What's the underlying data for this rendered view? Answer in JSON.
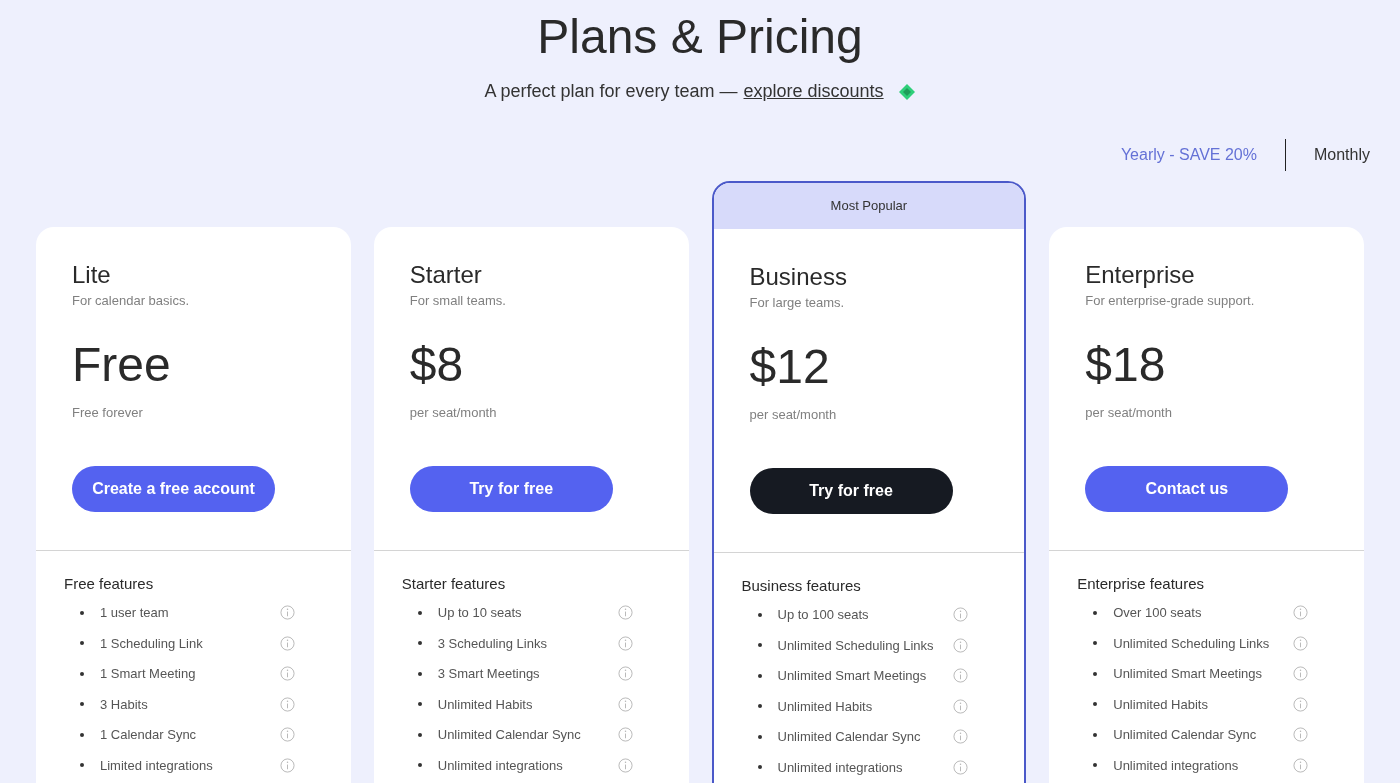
{
  "header": {
    "title": "Plans & Pricing",
    "subtitle": "A perfect plan for every team —",
    "link": "explore discounts"
  },
  "billing": [
    {
      "label": "Yearly - SAVE 20%",
      "selected": true
    },
    {
      "label": "Monthly",
      "selected": false
    }
  ],
  "plans": [
    {
      "name": "Lite",
      "tagline": "For calendar basics.",
      "price": "Free",
      "price_note": "Free forever",
      "button": "Create a free account",
      "featured": false,
      "features_title": "Free features",
      "features": [
        "1 user team",
        "1 Scheduling Link",
        "1 Smart Meeting",
        "3 Habits",
        "1 Calendar Sync",
        "Limited integrations"
      ]
    },
    {
      "name": "Starter",
      "tagline": "For small teams.",
      "price": "$8",
      "price_note": "per seat/month",
      "button": "Try for free",
      "featured": false,
      "features_title": "Starter features",
      "features": [
        "Up to 10 seats",
        "3 Scheduling Links",
        "3 Smart Meetings",
        "Unlimited Habits",
        "Unlimited Calendar Sync",
        "Unlimited integrations"
      ]
    },
    {
      "name": "Business",
      "tagline": "For large teams.",
      "price": "$12",
      "price_note": "per seat/month",
      "button": "Try for free",
      "featured": true,
      "badge": "Most Popular",
      "features_title": "Business features",
      "features": [
        "Up to 100 seats",
        "Unlimited Scheduling Links",
        "Unlimited Smart Meetings",
        "Unlimited Habits",
        "Unlimited Calendar Sync",
        "Unlimited integrations"
      ]
    },
    {
      "name": "Enterprise",
      "tagline": "For enterprise-grade support.",
      "price": "$18",
      "price_note": "per seat/month",
      "button": "Contact us",
      "featured": false,
      "features_title": "Enterprise features",
      "features": [
        "Over 100 seats",
        "Unlimited Scheduling Links",
        "Unlimited Smart Meetings",
        "Unlimited Habits",
        "Unlimited Calendar Sync",
        "Unlimited integrations"
      ]
    }
  ]
}
